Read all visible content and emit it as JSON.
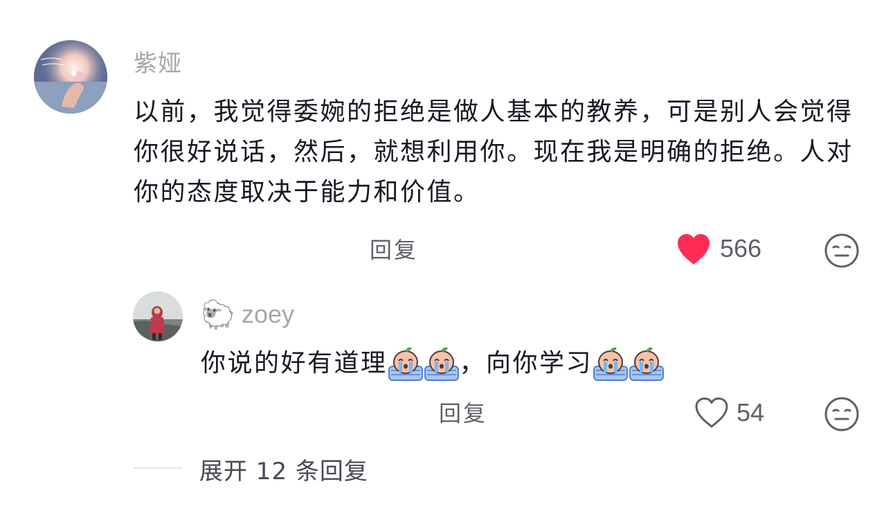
{
  "comment": {
    "author": "紫娅",
    "text": "以前，我觉得委婉的拒绝是做人基本的教养，可是别人会觉得你很好说话，然后，就想利用你。现在我是明确的拒绝。人对你的态度取决于能力和价值。",
    "reply_label": "回复",
    "like_count": "566",
    "liked": true,
    "like_color": "#fe2c55"
  },
  "reply": {
    "author_emoji": "🐑",
    "author": "zoey",
    "text_part1": "你说的好有道理",
    "text_part2": "，向你学习",
    "reply_label": "回复",
    "like_count": "54",
    "liked": false
  },
  "expand": {
    "label": "展开 12 条回复"
  },
  "icons": {
    "like_filled": "heart-filled-icon",
    "like_outline": "heart-outline-icon",
    "dislike": "meh-face-icon",
    "emoji": "crying-emoji"
  }
}
